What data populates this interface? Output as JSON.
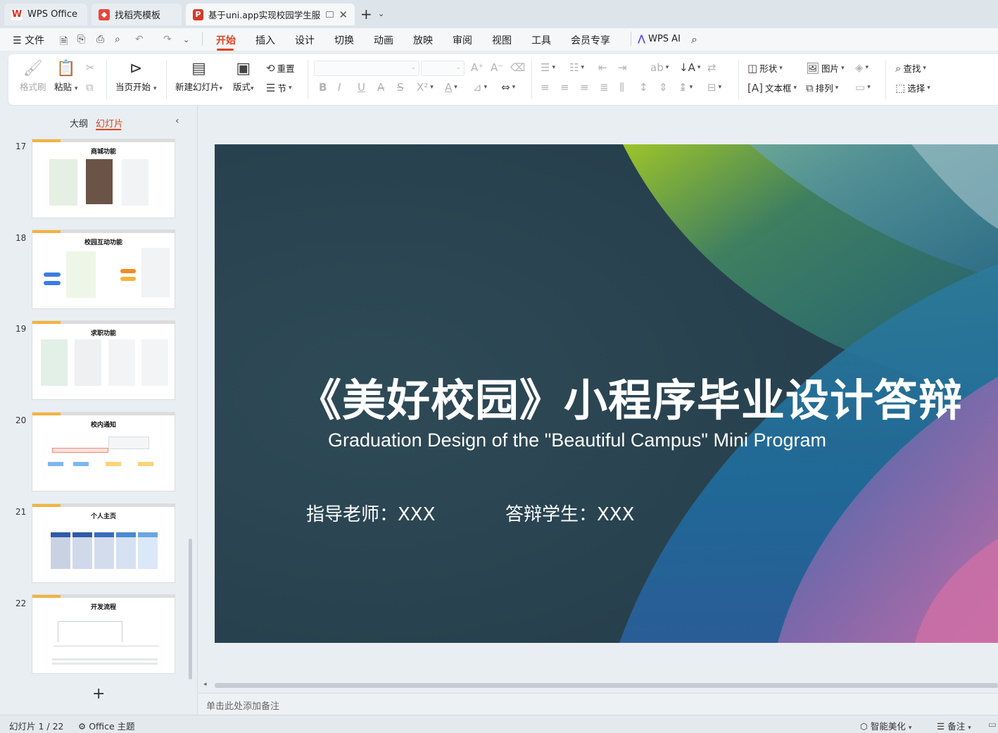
{
  "tabs": [
    {
      "label": "WPS Office",
      "icon": "wps-logo-icon"
    },
    {
      "label": "找稻壳模板",
      "icon": "docer-icon"
    },
    {
      "label": "基于uni.app实现校园学生服务",
      "icon": "presentation-file-icon",
      "active": true
    }
  ],
  "menu": {
    "file": "文件",
    "items": [
      "开始",
      "插入",
      "设计",
      "切换",
      "动画",
      "放映",
      "审阅",
      "视图",
      "工具",
      "会员专享"
    ],
    "active": "开始",
    "ai": "WPS AI"
  },
  "ribbon": {
    "format_painter": "格式刷",
    "paste": "粘贴",
    "start_from_current": "当页开始",
    "new_slide": "新建幻灯片",
    "layout": "版式",
    "reset": "重置",
    "section": "节",
    "shape": "形状",
    "picture": "图片",
    "find": "查找",
    "textbox": "文本框",
    "arrange": "排列",
    "select": "选择"
  },
  "left_panel": {
    "tab_outline": "大纲",
    "tab_slides": "幻灯片",
    "thumbnails": [
      {
        "num": "17",
        "title": "商城功能"
      },
      {
        "num": "18",
        "title": "校园互动功能"
      },
      {
        "num": "19",
        "title": "求职功能"
      },
      {
        "num": "20",
        "title": "校内通知"
      },
      {
        "num": "21",
        "title": "个人主页"
      },
      {
        "num": "22",
        "title": "开发流程"
      }
    ],
    "add": "+"
  },
  "slide": {
    "title": "《美好校园》小程序毕业设计答辩",
    "subtitle": "Graduation Design of the \"Beautiful Campus\" Mini Program",
    "teacher": "指导老师：XXX",
    "student": "答辩学生：XXX"
  },
  "notes_placeholder": "单击此处添加备注",
  "status": {
    "slide_counter": "幻灯片 1 / 22",
    "theme": "Office 主题",
    "beautify": "智能美化",
    "notes": "备注"
  },
  "colors": {
    "accent": "#e0431f",
    "slide_bg": "#2b4452"
  }
}
